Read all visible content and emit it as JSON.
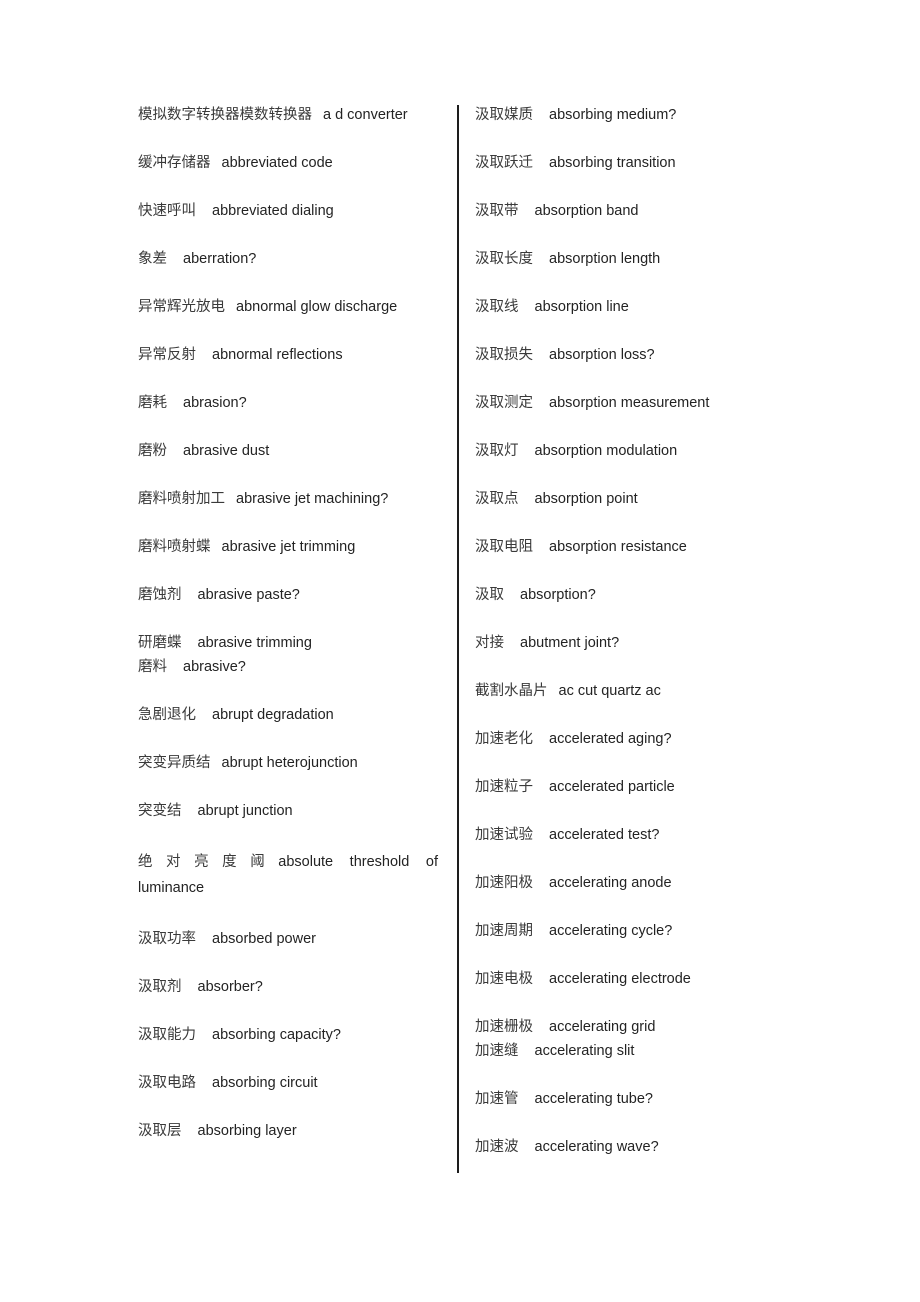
{
  "document": {
    "type": "bilingual-glossary",
    "layout": "two-column",
    "divider_color": "#1d1d1d"
  },
  "columns": {
    "left": [
      {
        "zh": "模拟数字转换器模数转换器",
        "en": "a d converter"
      },
      {
        "zh": "缓冲存储器",
        "en": "abbreviated code"
      },
      {
        "zh": "快速呼叫",
        "en": "abbreviated dialing"
      },
      {
        "zh": "象差",
        "en": "aberration?"
      },
      {
        "zh": "异常辉光放电",
        "en": "abnormal glow discharge"
      },
      {
        "zh": "异常反射",
        "en": "abnormal reflections"
      },
      {
        "zh": "磨耗",
        "en": "abrasion?"
      },
      {
        "zh": "磨粉",
        "en": "abrasive dust"
      },
      {
        "zh": "磨料喷射加工",
        "en": "abrasive jet machining?"
      },
      {
        "zh": "磨料喷射蝶",
        "en": "abrasive jet trimming"
      },
      {
        "zh": "磨蚀剂",
        "en": "abrasive paste?"
      },
      {
        "zh": "研磨蝶",
        "en": "abrasive trimming",
        "tight": true
      },
      {
        "zh": "磨料",
        "en": "abrasive?"
      },
      {
        "zh": "急剧退化",
        "en": "abrupt degradation"
      },
      {
        "zh": "突变异质结",
        "en": "abrupt heterojunction"
      },
      {
        "zh": "突变结",
        "en": "abrupt junction"
      },
      {
        "zh": "绝对亮度阈",
        "en": "absolute threshold of luminance",
        "justified": true,
        "en_line1": "absolute threshold of",
        "en_line2": "luminance"
      },
      {
        "zh": "汲取功率",
        "en": "absorbed power"
      },
      {
        "zh": "汲取剂",
        "en": "absorber?"
      },
      {
        "zh": "汲取能力",
        "en": "absorbing capacity?"
      },
      {
        "zh": "汲取电路",
        "en": "absorbing circuit"
      },
      {
        "zh": "汲取层",
        "en": "absorbing layer"
      }
    ],
    "right": [
      {
        "zh": "汲取媒质",
        "en": "absorbing medium?"
      },
      {
        "zh": "汲取跃迁",
        "en": "absorbing transition"
      },
      {
        "zh": "汲取带",
        "en": "absorption band"
      },
      {
        "zh": "汲取长度",
        "en": "absorption length"
      },
      {
        "zh": "汲取线",
        "en": "absorption line"
      },
      {
        "zh": "汲取损失",
        "en": "absorption loss?"
      },
      {
        "zh": "汲取测定",
        "en": "absorption measurement"
      },
      {
        "zh": "汲取灯",
        "en": "absorption modulation"
      },
      {
        "zh": "汲取点",
        "en": "absorption point"
      },
      {
        "zh": "汲取电阻",
        "en": "absorption resistance"
      },
      {
        "zh": "汲取",
        "en": "absorption?"
      },
      {
        "zh": "对接",
        "en": "abutment joint?"
      },
      {
        "zh": "截割水晶片",
        "en": "ac cut quartz ac"
      },
      {
        "zh": "加速老化",
        "en": "accelerated aging?"
      },
      {
        "zh": "加速粒子",
        "en": "accelerated particle"
      },
      {
        "zh": "加速试验",
        "en": "accelerated test?"
      },
      {
        "zh": "加速阳极",
        "en": "accelerating anode"
      },
      {
        "zh": "加速周期",
        "en": "accelerating cycle?"
      },
      {
        "zh": "加速电极",
        "en": "accelerating electrode"
      },
      {
        "zh": "加速栅极",
        "en": "accelerating grid",
        "tight": true
      },
      {
        "zh": "加速缝",
        "en": "accelerating slit"
      },
      {
        "zh": "加速管",
        "en": "accelerating tube?"
      },
      {
        "zh": "加速波",
        "en": "accelerating wave?"
      }
    ]
  }
}
